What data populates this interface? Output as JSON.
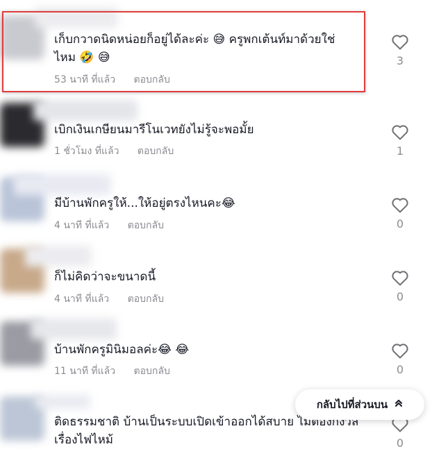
{
  "comments": [
    {
      "avatar_color": "#c9cad0",
      "text_lines": [
        "เก็บกวาดนิดหน่อยก็อยู่ได้ละค่ะ 😅 ครูพกเต้นท์มาด้วยใช่",
        "ไหม 🤣 😅"
      ],
      "time": "53 นาที ที่แล้ว",
      "reply": "ตอบกลับ",
      "likes": "3"
    },
    {
      "avatar_color": "#2b2b2f",
      "text_lines": [
        "เบิกเงินเกษียนมารีโนเวทยังไม่รู้จะพอมั้ย"
      ],
      "time": "1 ชั่วโมง ที่แล้ว",
      "reply": "ตอบกลับ",
      "likes": "1"
    },
    {
      "avatar_color": "#b9c4d8",
      "text_lines": [
        "มีบ้านพักครูให้...ให้อยู่ตรงไหนคะ😂"
      ],
      "time": "4 นาที ที่แล้ว",
      "reply": "ตอบกลับ",
      "likes": "0"
    },
    {
      "avatar_color": "#c8a98a",
      "text_lines": [
        "ก็ไม่คิดว่าจะขนาดนี้"
      ],
      "time": "4 นาที ที่แล้ว",
      "reply": "ตอบกลับ",
      "likes": "0"
    },
    {
      "avatar_color": "#9a9ba3",
      "text_lines": [
        "บ้านพักครูมินิมอลค่ะ😂 😂"
      ],
      "time": "11 นาที ที่แล้ว",
      "reply": "ตอบกลับ",
      "likes": "0"
    },
    {
      "avatar_color": "#bcc6d6",
      "text_lines": [
        "ติดธรรมชาติ บ้านเป็นระบบเปิดเข้าออกได้สบาย ไม่ต้องกังวล",
        "เรื่องไฟไหม้"
      ],
      "time": "",
      "reply": "",
      "likes": "0"
    }
  ],
  "back_to_top": {
    "label": "กลับไปที่ส่วนบน",
    "icon": "chevron-up-double-icon"
  },
  "colors": {
    "highlight_border": "#e03c3c",
    "meta_text": "#8a8b91",
    "comment_text": "#161823"
  }
}
